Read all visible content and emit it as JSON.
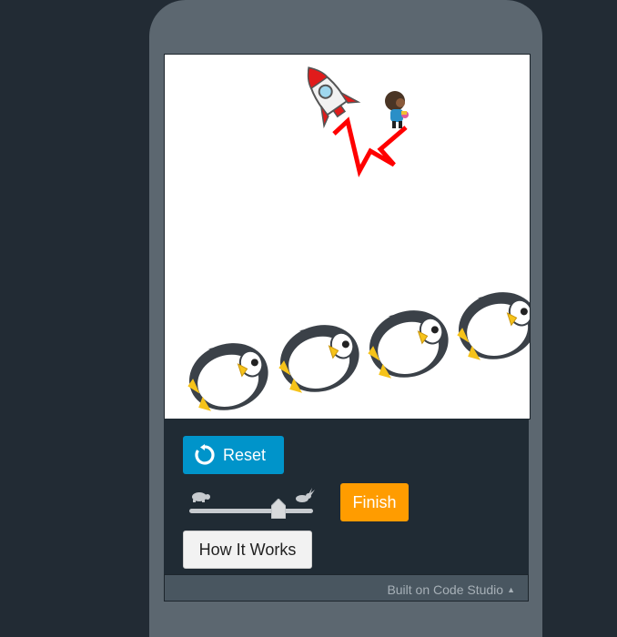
{
  "controls": {
    "reset_label": "Reset",
    "finish_label": "Finish",
    "how_it_works_label": "How It Works",
    "speed_slider": {
      "min_icon": "turtle-icon",
      "max_icon": "rabbit-icon",
      "value": 0.75
    }
  },
  "footer": {
    "text": "Built on Code Studio",
    "arrow": "▲"
  },
  "stage": {
    "sprites": [
      "rocket",
      "astronaut",
      "penguin",
      "penguin",
      "penguin",
      "penguin"
    ],
    "drawn_line_color": "#ff0000"
  },
  "colors": {
    "background": "#222b34",
    "phone_frame": "#5c6770",
    "reset": "#0094ca",
    "finish": "#ff9c00"
  }
}
